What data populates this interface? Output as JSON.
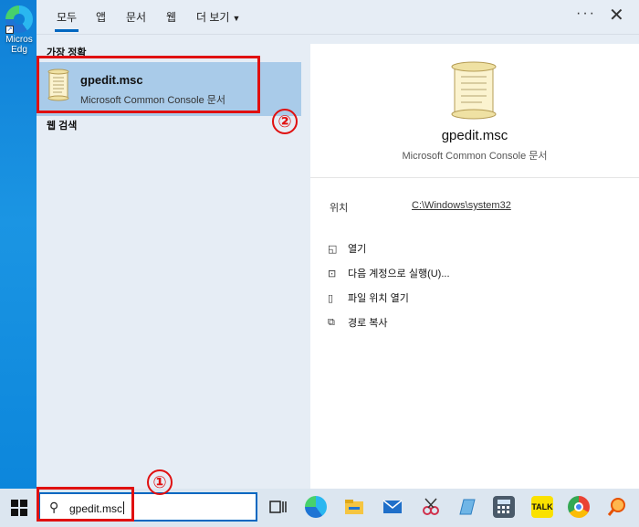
{
  "desktop": {
    "icon_label": "Micros\nEdg"
  },
  "tabs": [
    {
      "label": "모두",
      "active": true
    },
    {
      "label": "앱"
    },
    {
      "label": "문서"
    },
    {
      "label": "웹"
    },
    {
      "label": "더 보기"
    }
  ],
  "header": {
    "more_icon": "ellipsis-icon",
    "close_icon": "close-icon"
  },
  "results": {
    "best_match_heading": "가장 정확",
    "best": {
      "name": "gpedit.msc",
      "type": "Microsoft Common Console 문서",
      "icon": "scroll-document-icon"
    },
    "web_heading": "웹 검색"
  },
  "preview": {
    "title": "gpedit.msc",
    "subtitle": "Microsoft Common Console 문서",
    "location_label": "위치",
    "location_value": "C:\\Windows\\system32",
    "actions": [
      {
        "label": "열기",
        "icon": "open-icon"
      },
      {
        "label": "다음 계정으로 실행(U)...",
        "icon": "run-as-icon"
      },
      {
        "label": "파일 위치 열기",
        "icon": "file-location-icon"
      },
      {
        "label": "경로 복사",
        "icon": "copy-path-icon"
      }
    ]
  },
  "taskbar": {
    "search_value": "gpedit.msc",
    "apps": [
      "task-view-icon",
      "edge-icon",
      "file-explorer-icon",
      "mail-icon",
      "snipping-icon",
      "app-icon",
      "calculator-icon",
      "kakaotalk-icon",
      "chrome-icon",
      "search-app-icon"
    ],
    "kakao_label": "TALK"
  },
  "annotations": {
    "step1": "①",
    "step2": "②"
  },
  "colors": {
    "accent": "#0067c0",
    "highlight": "#a9cbe9",
    "annotation_red": "#e01010",
    "panel_bg": "#e6edf5"
  }
}
